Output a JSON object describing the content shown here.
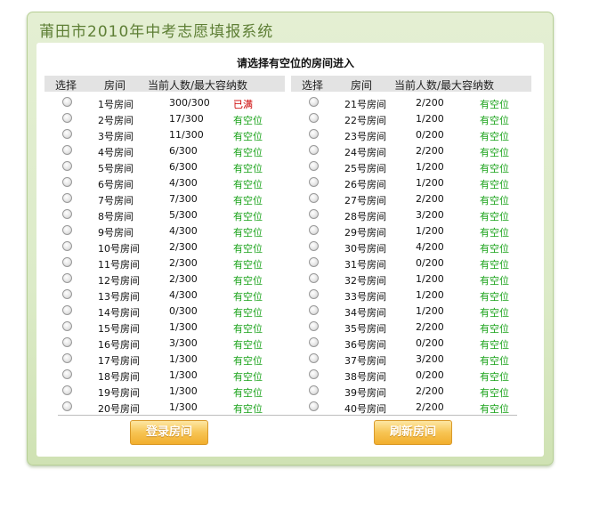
{
  "app": {
    "title": "莆田市2010年中考志愿填报系统"
  },
  "main": {
    "heading": "请选择有空位的房间进入",
    "columns": {
      "select": "选择",
      "room": "房间",
      "count": "当前人数/最大容纳数"
    },
    "left_rooms": [
      {
        "name": "1号房间",
        "count": "300/300",
        "status": "已满"
      },
      {
        "name": "2号房间",
        "count": "17/300",
        "status": "有空位"
      },
      {
        "name": "3号房间",
        "count": "11/300",
        "status": "有空位"
      },
      {
        "name": "4号房间",
        "count": "6/300",
        "status": "有空位"
      },
      {
        "name": "5号房间",
        "count": "6/300",
        "status": "有空位"
      },
      {
        "name": "6号房间",
        "count": "4/300",
        "status": "有空位"
      },
      {
        "name": "7号房间",
        "count": "7/300",
        "status": "有空位"
      },
      {
        "name": "8号房间",
        "count": "5/300",
        "status": "有空位"
      },
      {
        "name": "9号房间",
        "count": "4/300",
        "status": "有空位"
      },
      {
        "name": "10号房间",
        "count": "2/300",
        "status": "有空位"
      },
      {
        "name": "11号房间",
        "count": "2/300",
        "status": "有空位"
      },
      {
        "name": "12号房间",
        "count": "2/300",
        "status": "有空位"
      },
      {
        "name": "13号房间",
        "count": "4/300",
        "status": "有空位"
      },
      {
        "name": "14号房间",
        "count": "0/300",
        "status": "有空位"
      },
      {
        "name": "15号房间",
        "count": "1/300",
        "status": "有空位"
      },
      {
        "name": "16号房间",
        "count": "3/300",
        "status": "有空位"
      },
      {
        "name": "17号房间",
        "count": "1/300",
        "status": "有空位"
      },
      {
        "name": "18号房间",
        "count": "1/300",
        "status": "有空位"
      },
      {
        "name": "19号房间",
        "count": "1/300",
        "status": "有空位"
      },
      {
        "name": "20号房间",
        "count": "1/300",
        "status": "有空位"
      }
    ],
    "right_rooms": [
      {
        "name": "21号房间",
        "count": "2/200",
        "status": "有空位"
      },
      {
        "name": "22号房间",
        "count": "1/200",
        "status": "有空位"
      },
      {
        "name": "23号房间",
        "count": "0/200",
        "status": "有空位"
      },
      {
        "name": "24号房间",
        "count": "2/200",
        "status": "有空位"
      },
      {
        "name": "25号房间",
        "count": "1/200",
        "status": "有空位"
      },
      {
        "name": "26号房间",
        "count": "1/200",
        "status": "有空位"
      },
      {
        "name": "27号房间",
        "count": "2/200",
        "status": "有空位"
      },
      {
        "name": "28号房间",
        "count": "3/200",
        "status": "有空位"
      },
      {
        "name": "29号房间",
        "count": "1/200",
        "status": "有空位"
      },
      {
        "name": "30号房间",
        "count": "4/200",
        "status": "有空位"
      },
      {
        "name": "31号房间",
        "count": "0/200",
        "status": "有空位"
      },
      {
        "name": "32号房间",
        "count": "1/200",
        "status": "有空位"
      },
      {
        "name": "33号房间",
        "count": "1/200",
        "status": "有空位"
      },
      {
        "name": "34号房间",
        "count": "1/200",
        "status": "有空位"
      },
      {
        "name": "35号房间",
        "count": "2/200",
        "status": "有空位"
      },
      {
        "name": "36号房间",
        "count": "0/200",
        "status": "有空位"
      },
      {
        "name": "37号房间",
        "count": "3/200",
        "status": "有空位"
      },
      {
        "name": "38号房间",
        "count": "0/200",
        "status": "有空位"
      },
      {
        "name": "39号房间",
        "count": "2/200",
        "status": "有空位"
      },
      {
        "name": "40号房间",
        "count": "2/200",
        "status": "有空位"
      }
    ]
  },
  "buttons": {
    "login": "登录房间",
    "refresh": "刷新房间"
  },
  "colors": {
    "full": "#cc0000",
    "available": "#1aa31a",
    "button": "#f7c453",
    "panel": "#dcebc8"
  }
}
